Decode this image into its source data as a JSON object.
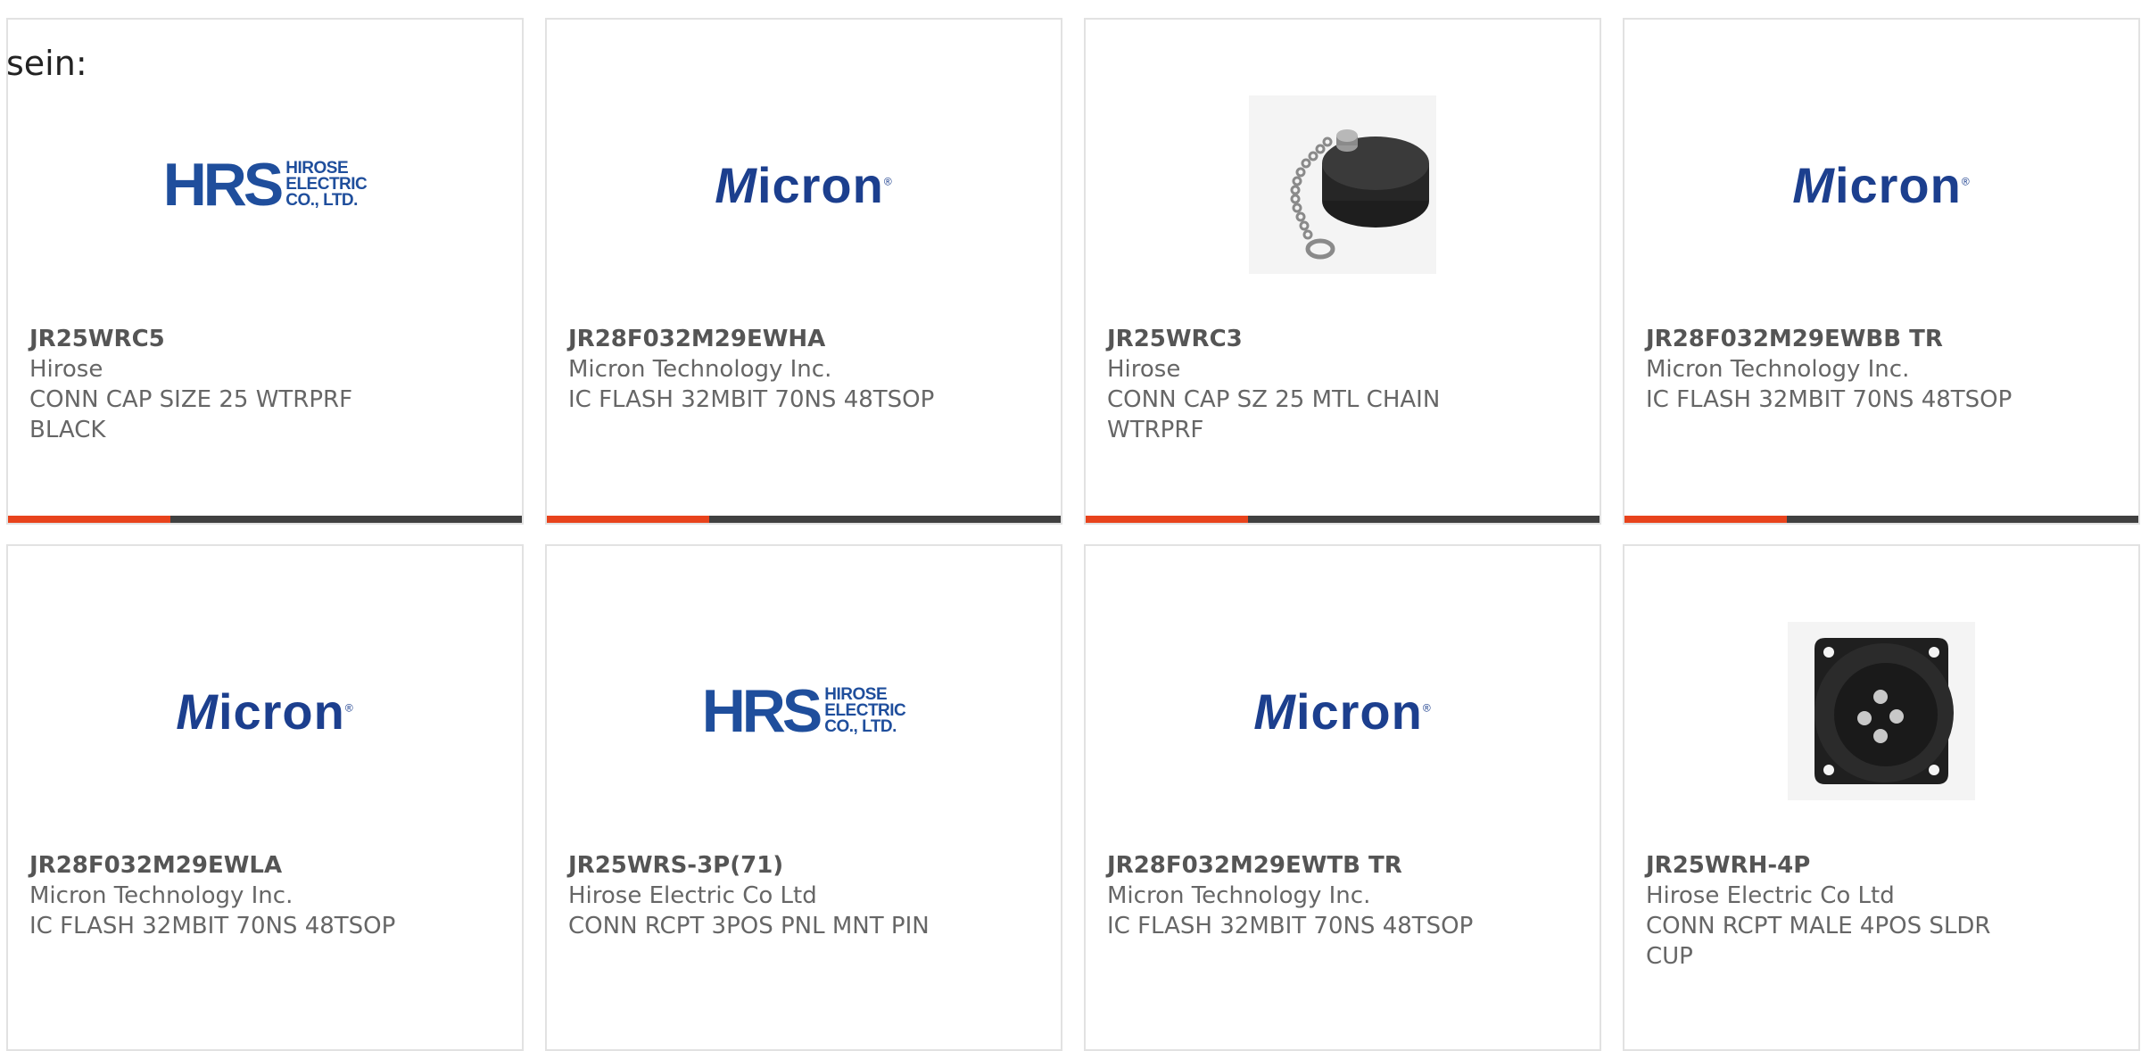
{
  "fragment_text": "sein:",
  "products": [
    {
      "part_number": "JR25WRC5",
      "manufacturer": "Hirose",
      "description": "CONN CAP SIZE 25 WTRPRF BLACK",
      "image": "hrs-logo",
      "logo": {
        "letters": "HRS",
        "line1": "HIROSE",
        "line2": "ELECTRIC",
        "line3": "CO., LTD."
      }
    },
    {
      "part_number": "JR28F032M29EWHA",
      "manufacturer": "Micron Technology Inc.",
      "description": "IC FLASH 32MBIT 70NS 48TSOP",
      "image": "micron-logo",
      "logo": {
        "initial": "M",
        "rest": "icron",
        "mark": "®"
      }
    },
    {
      "part_number": "JR25WRC3",
      "manufacturer": "Hirose",
      "description": "CONN CAP SZ 25 MTL CHAIN WTRPRF",
      "image": "cap-with-chain-photo"
    },
    {
      "part_number": "JR28F032M29EWBB TR",
      "manufacturer": "Micron Technology Inc.",
      "description": "IC FLASH 32MBIT 70NS 48TSOP",
      "image": "micron-logo",
      "logo": {
        "initial": "M",
        "rest": "icron",
        "mark": "®"
      }
    },
    {
      "part_number": "JR28F032M29EWLA",
      "manufacturer": "Micron Technology Inc.",
      "description": "IC FLASH 32MBIT 70NS 48TSOP",
      "image": "micron-logo",
      "logo": {
        "initial": "M",
        "rest": "icron",
        "mark": "®"
      }
    },
    {
      "part_number": "JR25WRS-3P(71)",
      "manufacturer": "Hirose Electric Co Ltd",
      "description": "CONN RCPT 3POS PNL MNT PIN",
      "image": "hrs-logo",
      "logo": {
        "letters": "HRS",
        "line1": "HIROSE",
        "line2": "ELECTRIC",
        "line3": "CO., LTD."
      }
    },
    {
      "part_number": "JR28F032M29EWTB TR",
      "manufacturer": "Micron Technology Inc.",
      "description": "IC FLASH 32MBIT 70NS 48TSOP",
      "image": "micron-logo",
      "logo": {
        "initial": "M",
        "rest": "icron",
        "mark": "®"
      }
    },
    {
      "part_number": "JR25WRH-4P",
      "manufacturer": "Hirose Electric Co Ltd",
      "description": "CONN RCPT MALE 4POS SLDR CUP",
      "image": "connector-receptacle-photo"
    }
  ],
  "colors": {
    "accent": "#e8431c",
    "bar": "#404040",
    "border": "#e2e2e2",
    "text": "#666666",
    "hrs_blue": "#1f4e9c",
    "micron_blue": "#1c3f8e"
  }
}
